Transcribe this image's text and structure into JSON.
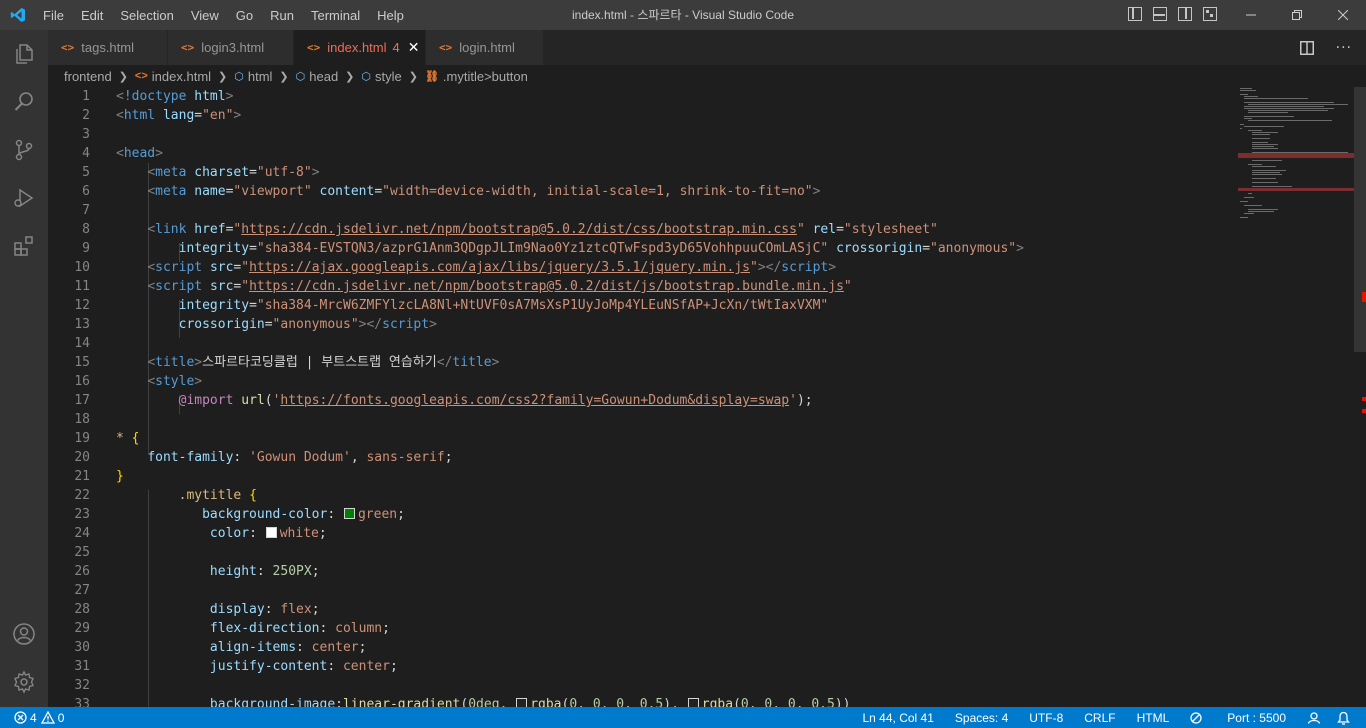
{
  "window": {
    "title": "index.html - 스파르타 - Visual Studio Code",
    "menu": [
      "File",
      "Edit",
      "Selection",
      "View",
      "Go",
      "Run",
      "Terminal",
      "Help"
    ]
  },
  "tabs": [
    {
      "label": "tags.html",
      "icon": "html-file-icon",
      "active": false
    },
    {
      "label": "login3.html",
      "icon": "html-file-icon",
      "active": false
    },
    {
      "label": "index.html",
      "icon": "html-file-icon",
      "active": true,
      "badge": "4"
    },
    {
      "label": "login.html",
      "icon": "html-file-icon",
      "active": false
    }
  ],
  "breadcrumb": {
    "folder": "frontend",
    "file": "index.html",
    "items": [
      "html",
      "head",
      "style"
    ],
    "last": ".mytitle>button"
  },
  "editor": {
    "line_numbers": [
      "1",
      "2",
      "3",
      "4",
      "5",
      "6",
      "7",
      "8",
      "9",
      "10",
      "11",
      "12",
      "13",
      "14",
      "15",
      "16",
      "17",
      "18",
      "19",
      "20",
      "21",
      "22",
      "23",
      "24",
      "25",
      "26",
      "27",
      "28",
      "29",
      "30",
      "31",
      "32",
      "33"
    ]
  },
  "status": {
    "errors": "4",
    "warnings": "0",
    "position": "Ln 44, Col 41",
    "spaces": "Spaces: 4",
    "encoding": "UTF-8",
    "eol": "CRLF",
    "language": "HTML",
    "port": "Port : 5500"
  },
  "colors": {
    "accent": "#007acc",
    "activity_bar": "#333333",
    "editor_bg": "#1e1e1e"
  }
}
